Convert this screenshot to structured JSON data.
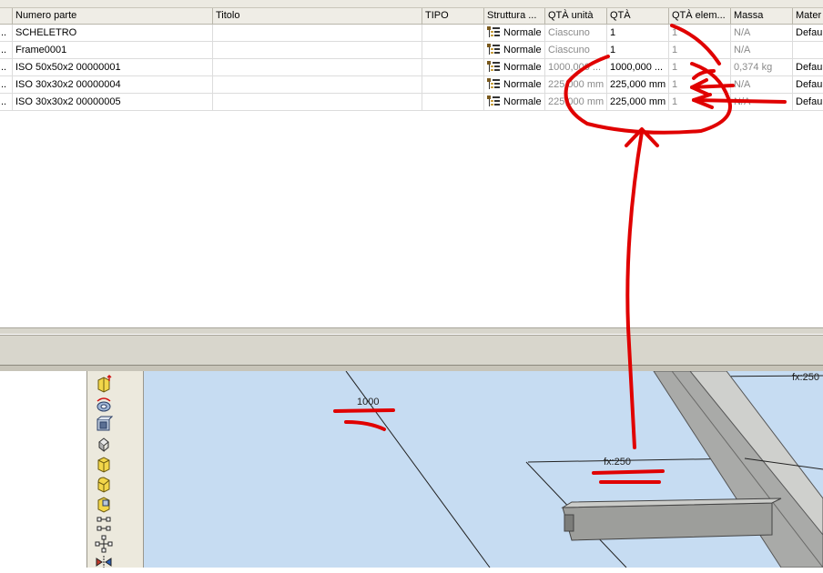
{
  "bom": {
    "columns": [
      "Numero parte",
      "Titolo",
      "TIPO",
      "Struttura ...",
      "QTÀ unità",
      "QTÀ",
      "QTÀ elem...",
      "Massa",
      "Mater"
    ],
    "rows": [
      {
        "part": "SCHELETRO",
        "title": "",
        "tipo": "",
        "struct": "Normale",
        "unit_qty": "Ciascuno",
        "qty": "1",
        "elem_qty": "1",
        "mass": "N/A",
        "material": "Defau"
      },
      {
        "part": "Frame0001",
        "title": "",
        "tipo": "",
        "struct": "Normale",
        "unit_qty": "Ciascuno",
        "qty": "1",
        "elem_qty": "1",
        "mass": "N/A",
        "material": ""
      },
      {
        "part": "ISO 50x50x2 00000001",
        "title": "",
        "tipo": "",
        "struct": "Normale",
        "unit_qty": "1000,000 ...",
        "qty": "1000,000 ...",
        "elem_qty": "1",
        "mass": "0,374 kg",
        "material": "Defau"
      },
      {
        "part": "ISO 30x30x2 00000004",
        "title": "",
        "tipo": "",
        "struct": "Normale",
        "unit_qty": "225,000 mm",
        "qty": "225,000 mm",
        "elem_qty": "1",
        "mass": "N/A",
        "material": "Defau"
      },
      {
        "part": "ISO 30x30x2 00000005",
        "title": "",
        "tipo": "",
        "struct": "Normale",
        "unit_qty": "225,000 mm",
        "qty": "225,000 mm",
        "elem_qty": "1",
        "mass": "N/A",
        "material": "Defau"
      }
    ],
    "row_prefix": ".."
  },
  "tools": [
    "extrude-icon",
    "revolve-icon",
    "shell-icon",
    "rotate-icon",
    "chamfer-icon",
    "fillet-icon",
    "box-icon",
    "constraint-icon",
    "pattern-icon",
    "mirror-icon"
  ],
  "viewport": {
    "dim_1000": "1000",
    "dim_fx250_a": "fx:250",
    "dim_fx250_b": "fx:250"
  },
  "colors": {
    "annotation": "#e00000",
    "viewport_bg": "#c6dcf2",
    "header_bg": "#efede6"
  }
}
